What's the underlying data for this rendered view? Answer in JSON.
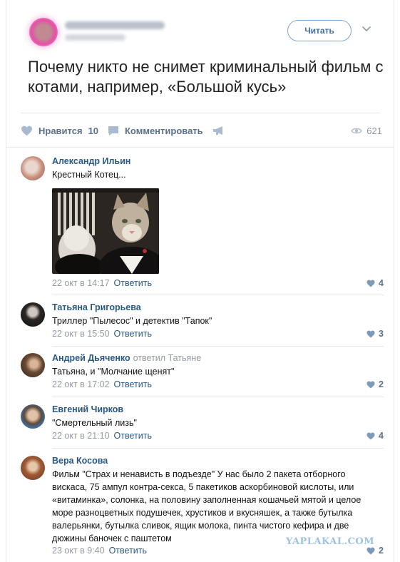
{
  "post": {
    "follow_label": "Читать",
    "title": "Почему никто не снимет криминальный фильм с котами, например, «Большой кусь»",
    "like_label": "Нравится",
    "like_count": "10",
    "comment_label": "Комментировать",
    "views": "621"
  },
  "comments": [
    {
      "name": "Александр Ильин",
      "text": "Крестный Котец...",
      "date": "22 окт в 14:17",
      "reply_label": "Ответить",
      "likes": "4"
    },
    {
      "name": "Татьяна Григорьева",
      "text": "Триллер \"Пылесос\" и детектив \"Тапок\"",
      "date": "22 окт в 15:50",
      "reply_label": "Ответить",
      "likes": "3"
    },
    {
      "name": "Андрей Дьяченко",
      "reply_to": "ответил Татьяне",
      "text": "Татьяна, и \"Молчание щенят\"",
      "date": "22 окт в 17:02",
      "reply_label": "Ответить",
      "likes": "2"
    },
    {
      "name": "Евгений Чирков",
      "text": "\"Смертельный лизь\"",
      "date": "22 окт в 21:10",
      "reply_label": "Ответить",
      "likes": "4"
    },
    {
      "name": "Вера Косова",
      "text": "Фильм \"Страх и ненависть в подъезде\" У нас было 2 пакета отборного вискаса, 75 ампул контра-секса, 5 пакетиков аскорбиновой кислоты, или «витаминка», солонка, на половину заполненная кошачьей мятой и целое море разноцветных подушечек, хрустиков и вкусняшек, а также бутылка валерьянки, бутылка сливок, ящик молока, пинта чистого кефира и две дюжины баночек с паштетом",
      "date": "23 окт в 9:40",
      "reply_label": "Ответить",
      "likes": "2"
    }
  ],
  "watermark": "YAPLAKAL.COM",
  "colors": {
    "link": "#2a5885",
    "muted": "#939aa3",
    "action": "#5b7188",
    "like_icon": "#7f9ab8"
  },
  "icons": [
    "heart-icon",
    "comment-icon",
    "share-icon",
    "eye-icon",
    "chevron-down-icon"
  ]
}
